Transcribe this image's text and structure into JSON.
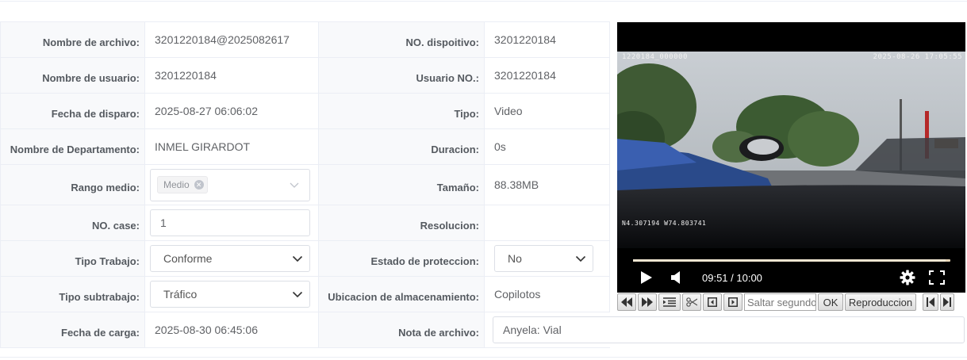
{
  "fields": {
    "nombre_archivo": {
      "label": "Nombre de archivo:",
      "value": "3201220184@2025082617"
    },
    "no_dispositivo": {
      "label": "NO. dispoitivo:",
      "value": "3201220184"
    },
    "nombre_usuario": {
      "label": "Nombre de usuario:",
      "value": "3201220184"
    },
    "usuario_no": {
      "label": "Usuario NO.:",
      "value": "3201220184"
    },
    "fecha_disparo": {
      "label": "Fecha de disparo:",
      "value": "2025-08-27 06:06:02"
    },
    "tipo": {
      "label": "Tipo:",
      "value": "Video"
    },
    "nombre_departamento": {
      "label": "Nombre de Departamento:",
      "value": "INMEL GIRARDOT"
    },
    "duracion": {
      "label": "Duracion:",
      "value": "0s"
    },
    "rango_medio": {
      "label": "Rango medio:",
      "tag": "Medio"
    },
    "tamano": {
      "label": "Tamaño:",
      "value": "88.38MB"
    },
    "no_case": {
      "label": "NO. case:",
      "value": "1"
    },
    "resolucion": {
      "label": "Resolucion:",
      "value": ""
    },
    "tipo_trabajo": {
      "label": "Tipo Trabajo:",
      "value": "Conforme"
    },
    "estado_proteccion": {
      "label": "Estado de proteccion:",
      "value": "No"
    },
    "tipo_subtrabajo": {
      "label": "Tipo subtrabajo:",
      "value": "Tráfico"
    },
    "ubicacion": {
      "label": "Ubicacion de almacenamiento:",
      "value": "Copilotos"
    },
    "fecha_carga": {
      "label": "Fecha de carga:",
      "value": "2025-08-30 06:45:06"
    },
    "nota_archivo": {
      "label": "Nota de archivo:",
      "value": "Anyela: Vial"
    }
  },
  "video": {
    "osd_top_left": "1220184_000000",
    "osd_top_right": "2025-08-26 17:05:55",
    "osd_gps": "N4.307194  W74.803741",
    "time_display": "09:51 / 10:00",
    "progress": 0.985
  },
  "controls": {
    "seek_placeholder": "Saltar segundos",
    "ok_label": "OK",
    "playback_label": "Reproduccion"
  },
  "colors": {
    "label_bg": "#f8f9fb",
    "border": "#ebeef5",
    "text": "#606266"
  }
}
